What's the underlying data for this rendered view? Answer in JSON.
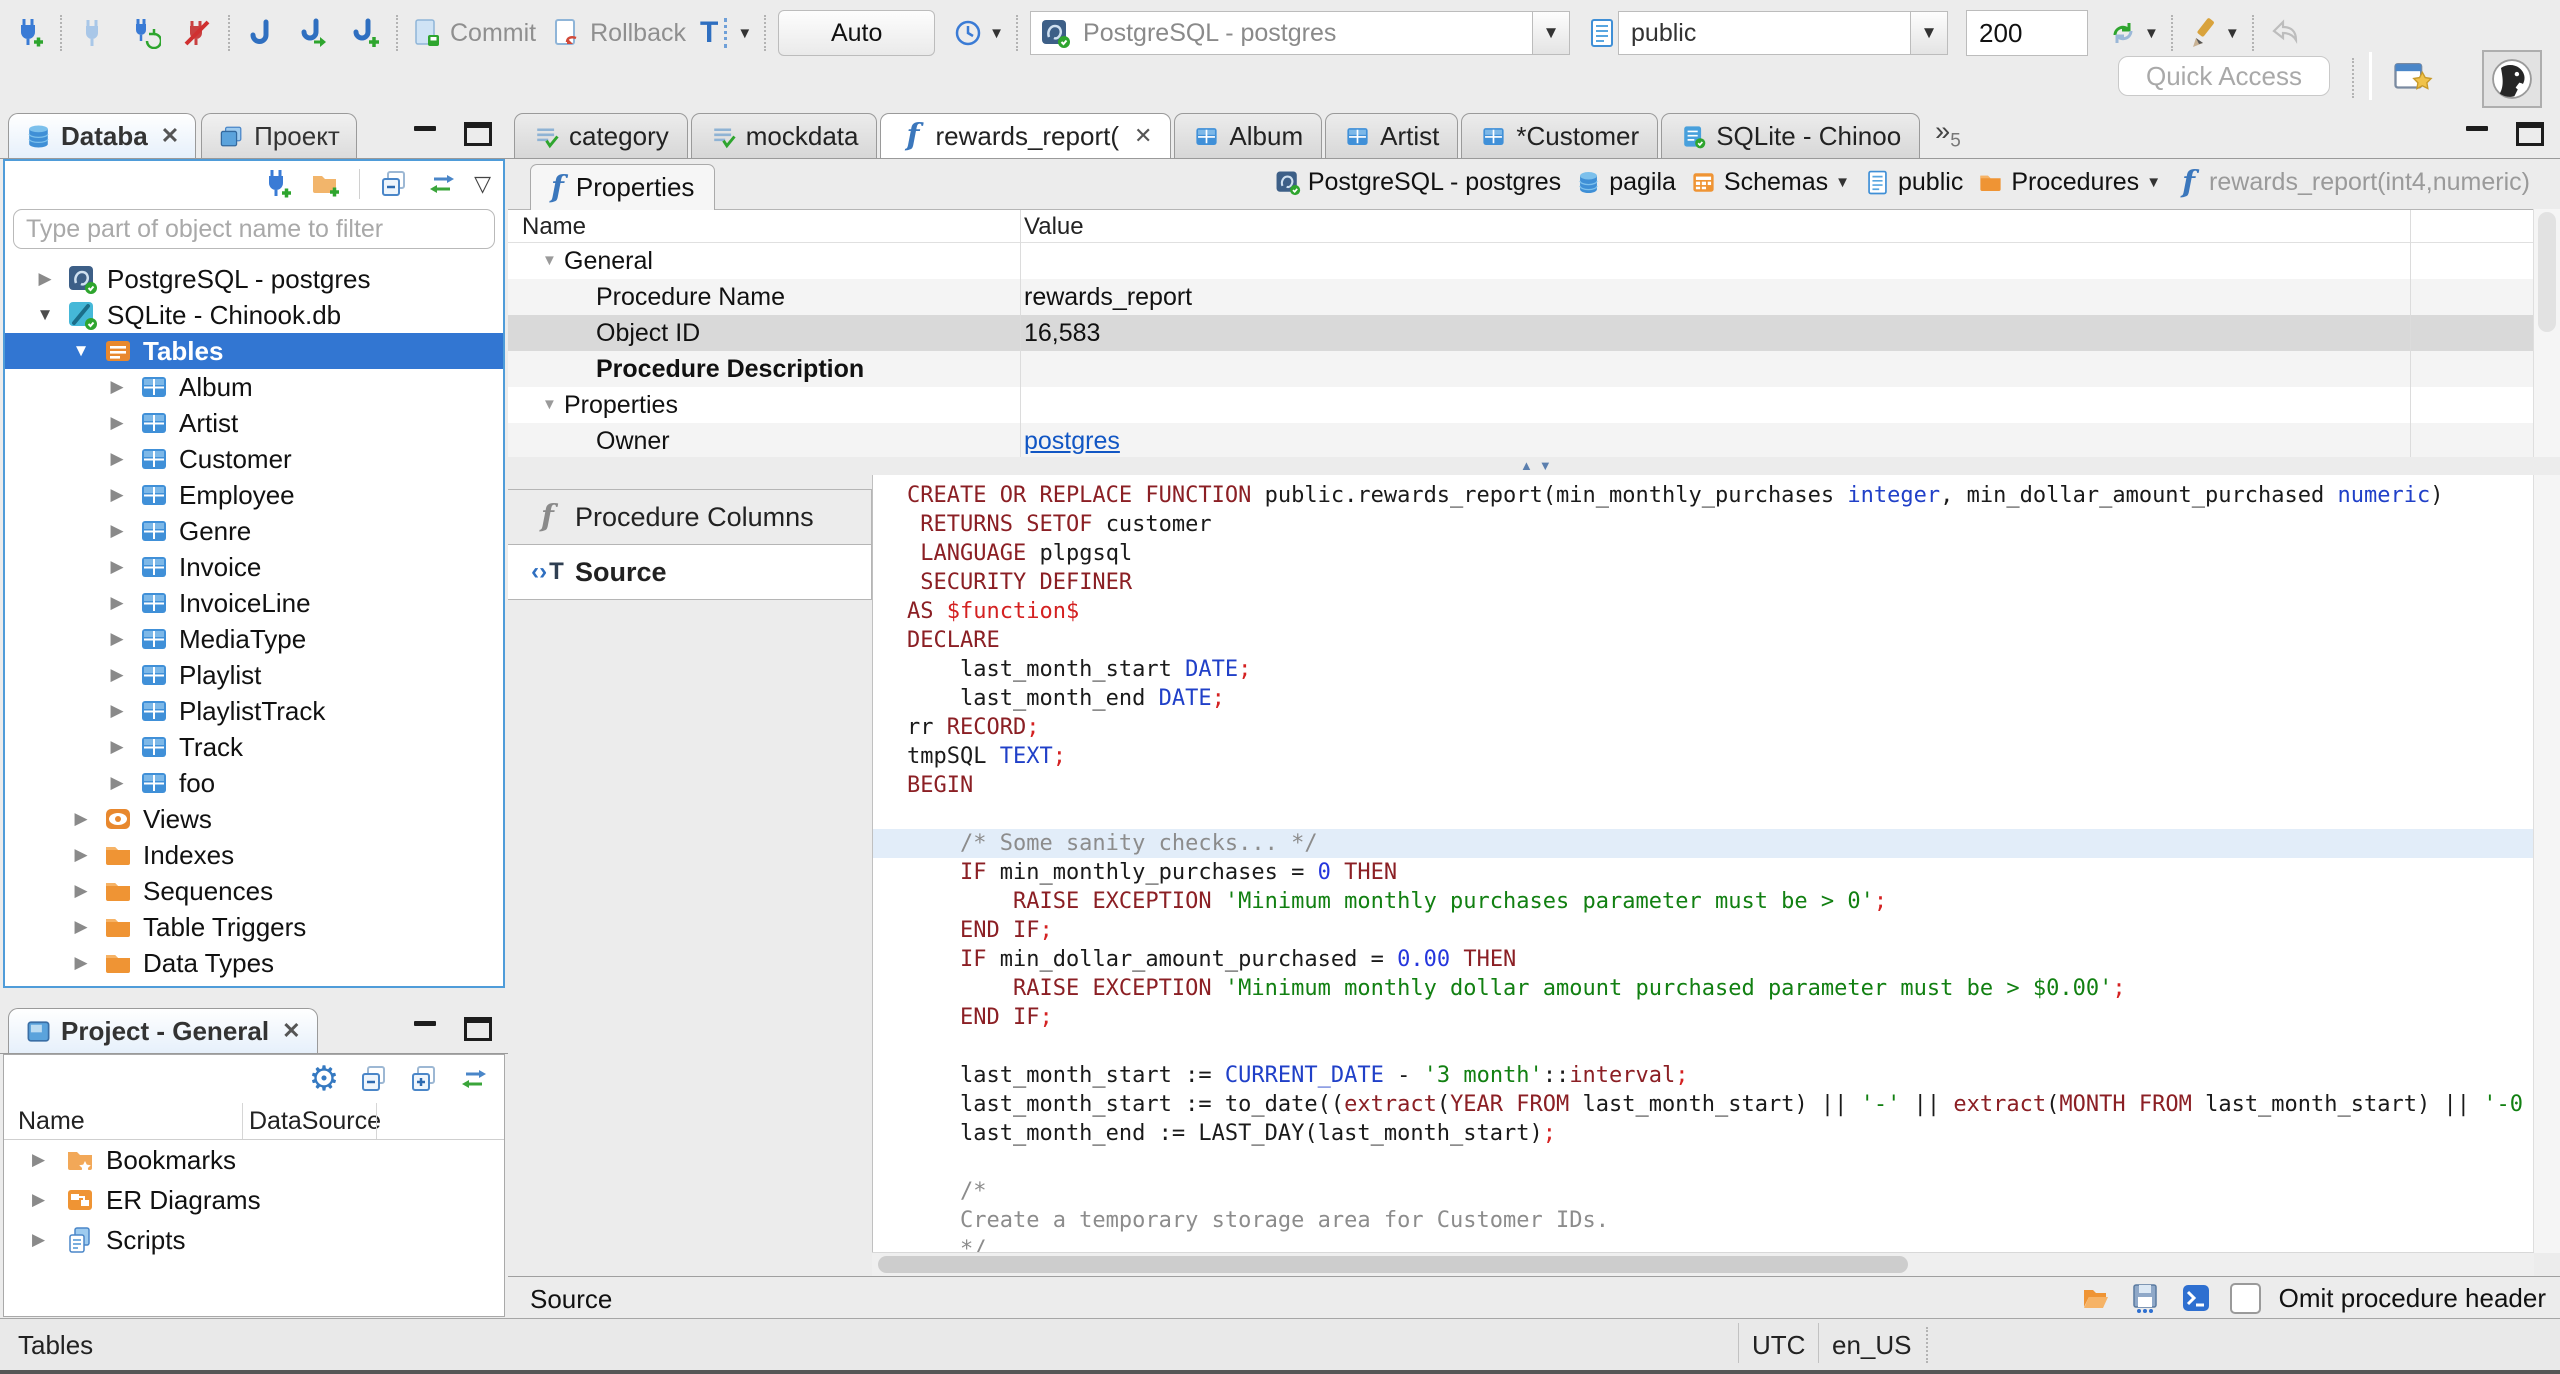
{
  "window": {
    "status_left": "Tables",
    "timezone": "UTC",
    "locale": "en_US"
  },
  "colors": {
    "selection": "#3276d2",
    "link": "#1156c4",
    "focus_border": "#4f9cd9",
    "keyword": "#8b1f24",
    "type": "#2040c8",
    "string": "#128012",
    "number": "#2536dd",
    "red": "#d42121",
    "comment": "#8c8c8c",
    "plain": "#1a1a1a",
    "highlight_line": "#e2edf9"
  },
  "toolbar": {
    "commit": "Commit",
    "rollback": "Rollback",
    "auto": "Auto",
    "connection": "PostgreSQL - postgres",
    "schema": "public",
    "fetch_size": "200",
    "quick_access": "Quick Access"
  },
  "navigator": {
    "tab_database": "Databa",
    "tab_project": "Проект",
    "filter_placeholder": "Type part of object name to filter",
    "tree": [
      {
        "label": "PostgreSQL - postgres",
        "icon": "postgres",
        "arrow": "right",
        "level": 0
      },
      {
        "label": "SQLite - Chinook.db",
        "icon": "sqlite",
        "arrow": "down",
        "level": 0
      },
      {
        "label": "Tables",
        "icon": "tables",
        "arrow": "down",
        "level": 1,
        "selected": true
      },
      {
        "label": "Album",
        "icon": "table",
        "arrow": "right",
        "level": 2
      },
      {
        "label": "Artist",
        "icon": "table",
        "arrow": "right",
        "level": 2
      },
      {
        "label": "Customer",
        "icon": "table",
        "arrow": "right",
        "level": 2
      },
      {
        "label": "Employee",
        "icon": "table",
        "arrow": "right",
        "level": 2
      },
      {
        "label": "Genre",
        "icon": "table",
        "arrow": "right",
        "level": 2
      },
      {
        "label": "Invoice",
        "icon": "table",
        "arrow": "right",
        "level": 2
      },
      {
        "label": "InvoiceLine",
        "icon": "table",
        "arrow": "right",
        "level": 2
      },
      {
        "label": "MediaType",
        "icon": "table",
        "arrow": "right",
        "level": 2
      },
      {
        "label": "Playlist",
        "icon": "table",
        "arrow": "right",
        "level": 2
      },
      {
        "label": "PlaylistTrack",
        "icon": "table",
        "arrow": "right",
        "level": 2
      },
      {
        "label": "Track",
        "icon": "table",
        "arrow": "right",
        "level": 2
      },
      {
        "label": "foo",
        "icon": "table",
        "arrow": "right",
        "level": 2
      },
      {
        "label": "Views",
        "icon": "views",
        "arrow": "right",
        "level": 1
      },
      {
        "label": "Indexes",
        "icon": "folder",
        "arrow": "right",
        "level": 1
      },
      {
        "label": "Sequences",
        "icon": "folder",
        "arrow": "right",
        "level": 1
      },
      {
        "label": "Table Triggers",
        "icon": "folder",
        "arrow": "right",
        "level": 1
      },
      {
        "label": "Data Types",
        "icon": "folder",
        "arrow": "right",
        "level": 1
      }
    ]
  },
  "project": {
    "title": "Project - General",
    "columns": [
      "Name",
      "DataSource"
    ],
    "items": [
      {
        "label": "Bookmarks",
        "icon": "bookmarks"
      },
      {
        "label": "ER Diagrams",
        "icon": "er"
      },
      {
        "label": "Scripts",
        "icon": "scripts"
      }
    ]
  },
  "editor": {
    "tabs": [
      {
        "label": "category",
        "icon": "script-check"
      },
      {
        "label": "mockdata",
        "icon": "script-check"
      },
      {
        "label": "rewards_report(",
        "icon": "func",
        "active": true,
        "close": true
      },
      {
        "label": "Album",
        "icon": "table"
      },
      {
        "label": "Artist",
        "icon": "table"
      },
      {
        "label": "*Customer",
        "icon": "table"
      },
      {
        "label": "SQLite - Chinoo",
        "icon": "sqlfile"
      }
    ],
    "tabs_overflow": "5",
    "properties_tab": "Properties",
    "breadcrumb": [
      {
        "label": "PostgreSQL - postgres",
        "icon": "postgres"
      },
      {
        "label": "pagila",
        "icon": "db"
      },
      {
        "label": "Schemas",
        "icon": "schemas",
        "dropdown": true
      },
      {
        "label": "public",
        "icon": "page"
      },
      {
        "label": "Procedures",
        "icon": "folder",
        "dropdown": true
      },
      {
        "label": "rewards_report(int4,numeric)",
        "icon": "func",
        "muted": true
      }
    ],
    "grid": {
      "name_header": "Name",
      "value_header": "Value",
      "rows": [
        {
          "name": "General",
          "group": true
        },
        {
          "name": "Procedure Name",
          "value": "rewards_report",
          "stripe": true
        },
        {
          "name": "Object ID",
          "value": "16,583",
          "selected": true
        },
        {
          "name": "Procedure Description",
          "bold": true,
          "stripe": true
        },
        {
          "name": "Properties",
          "group": true
        },
        {
          "name": "Owner",
          "value": "postgres",
          "link": true,
          "stripe": true
        }
      ]
    },
    "side_tabs": [
      {
        "label": "Procedure Columns",
        "icon": "func-gray"
      },
      {
        "label": "Source",
        "icon": "src",
        "active": true
      }
    ],
    "code": [
      {
        "t": [
          [
            "k",
            "CREATE OR REPLACE FUNCTION "
          ],
          [
            "p",
            "public.rewards_report(min_monthly_purchases "
          ],
          [
            "y",
            "integer"
          ],
          [
            "p",
            ", min_dollar_amount_purchased "
          ],
          [
            "y",
            "numeric"
          ],
          [
            "p",
            ")"
          ]
        ]
      },
      {
        "t": [
          [
            "p",
            " "
          ],
          [
            "k",
            "RETURNS SETOF "
          ],
          [
            "p",
            "customer"
          ]
        ]
      },
      {
        "t": [
          [
            "p",
            " "
          ],
          [
            "k",
            "LANGUAGE "
          ],
          [
            "p",
            "plpgsql"
          ]
        ]
      },
      {
        "t": [
          [
            "p",
            " "
          ],
          [
            "k",
            "SECURITY DEFINER"
          ]
        ]
      },
      {
        "t": [
          [
            "k",
            "AS "
          ],
          [
            "r",
            "$function$"
          ]
        ]
      },
      {
        "t": [
          [
            "k",
            "DECLARE"
          ]
        ]
      },
      {
        "t": [
          [
            "p",
            "    last_month_start "
          ],
          [
            "y",
            "DATE"
          ],
          [
            "r",
            ";"
          ]
        ]
      },
      {
        "t": [
          [
            "p",
            "    last_month_end "
          ],
          [
            "y",
            "DATE"
          ],
          [
            "r",
            ";"
          ]
        ]
      },
      {
        "t": [
          [
            "p",
            "rr "
          ],
          [
            "k",
            "RECORD"
          ],
          [
            "r",
            ";"
          ]
        ]
      },
      {
        "t": [
          [
            "p",
            "tmpSQL "
          ],
          [
            "y",
            "TEXT"
          ],
          [
            "r",
            ";"
          ]
        ]
      },
      {
        "t": [
          [
            "k",
            "BEGIN"
          ]
        ]
      },
      {
        "t": []
      },
      {
        "hl": true,
        "t": [
          [
            "c",
            "    /* Some sanity checks... */"
          ]
        ]
      },
      {
        "t": [
          [
            "p",
            "    "
          ],
          [
            "k",
            "IF "
          ],
          [
            "p",
            "min_monthly_purchases = "
          ],
          [
            "n",
            "0"
          ],
          [
            "k",
            " THEN"
          ]
        ]
      },
      {
        "t": [
          [
            "p",
            "        "
          ],
          [
            "k",
            "RAISE EXCEPTION "
          ],
          [
            "s",
            "'Minimum monthly purchases parameter must be > 0'"
          ],
          [
            "r",
            ";"
          ]
        ]
      },
      {
        "t": [
          [
            "p",
            "    "
          ],
          [
            "k",
            "END IF"
          ],
          [
            "r",
            ";"
          ]
        ]
      },
      {
        "t": [
          [
            "p",
            "    "
          ],
          [
            "k",
            "IF "
          ],
          [
            "p",
            "min_dollar_amount_purchased = "
          ],
          [
            "n",
            "0.00"
          ],
          [
            "k",
            " THEN"
          ]
        ]
      },
      {
        "t": [
          [
            "p",
            "        "
          ],
          [
            "k",
            "RAISE EXCEPTION "
          ],
          [
            "s",
            "'Minimum monthly dollar amount purchased parameter must be > $0.00'"
          ],
          [
            "r",
            ";"
          ]
        ]
      },
      {
        "t": [
          [
            "p",
            "    "
          ],
          [
            "k",
            "END IF"
          ],
          [
            "r",
            ";"
          ]
        ]
      },
      {
        "t": []
      },
      {
        "t": [
          [
            "p",
            "    last_month_start := "
          ],
          [
            "y",
            "CURRENT_DATE"
          ],
          [
            "p",
            " - "
          ],
          [
            "s",
            "'3 month'"
          ],
          [
            "p",
            "::"
          ],
          [
            "k",
            "interval"
          ],
          [
            "r",
            ";"
          ]
        ]
      },
      {
        "t": [
          [
            "p",
            "    last_month_start := to_date(("
          ],
          [
            "k",
            "extract"
          ],
          [
            "p",
            "("
          ],
          [
            "k",
            "YEAR FROM "
          ],
          [
            "p",
            "last_month_start) || "
          ],
          [
            "s",
            "'-'"
          ],
          [
            "p",
            " || "
          ],
          [
            "k",
            "extract"
          ],
          [
            "p",
            "("
          ],
          [
            "k",
            "MONTH FROM "
          ],
          [
            "p",
            "last_month_start) || "
          ],
          [
            "s",
            "'-0"
          ]
        ]
      },
      {
        "t": [
          [
            "p",
            "    last_month_end := LAST_DAY(last_month_start)"
          ],
          [
            "r",
            ";"
          ]
        ]
      },
      {
        "t": []
      },
      {
        "t": [
          [
            "c",
            "    /*"
          ]
        ]
      },
      {
        "t": [
          [
            "c",
            "    Create a temporary storage area for Customer IDs."
          ]
        ]
      },
      {
        "t": [
          [
            "c",
            "    */"
          ]
        ]
      }
    ],
    "bottom": {
      "label": "Source",
      "omit_checkbox_label": "Omit procedure header"
    }
  }
}
